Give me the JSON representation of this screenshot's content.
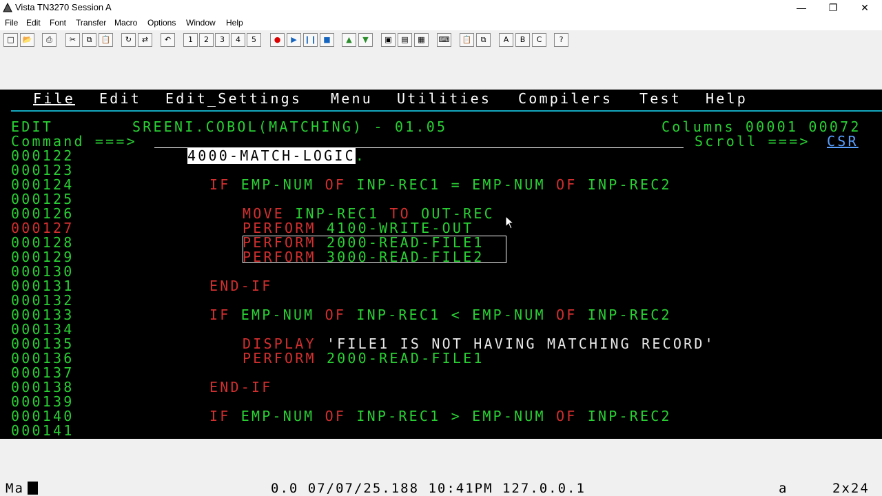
{
  "window": {
    "title": "Vista TN3270 Session A",
    "minimize_glyph": "—",
    "restore_glyph": "❐",
    "close_glyph": "✕"
  },
  "menubar": [
    "File",
    "Edit",
    "Font",
    "Transfer",
    "Macro",
    "Options",
    "Window",
    "Help"
  ],
  "toolbar": {
    "buttons": [
      "new",
      "open",
      "print",
      "cut",
      "copy",
      "paste",
      "refresh",
      "reconnect",
      "undo",
      "1",
      "2",
      "3",
      "4",
      "5",
      "record",
      "play",
      "pause",
      "stop",
      "upload",
      "download",
      "screen1",
      "screen2",
      "screen3",
      "keyboard",
      "clip1",
      "clip2",
      "A",
      "B",
      "C",
      "?"
    ]
  },
  "ispf": {
    "menu": [
      "File",
      "Edit",
      "Edit_Settings",
      "Menu",
      "Utilities",
      "Compilers",
      "Test",
      "Help"
    ],
    "mode": "EDIT",
    "dataset": "SREENI.COBOL(MATCHING) - 01.05",
    "columns": "Columns 00001 00072",
    "command_label": "Command ===>",
    "scroll_label": "Scroll ===>",
    "scroll_value": "CSR"
  },
  "lines": [
    {
      "num": "000122",
      "code": "4000-MATCH-LOGIC."
    },
    {
      "num": "000123",
      "code": ""
    },
    {
      "num": "000124",
      "code": "IF EMP-NUM OF INP-REC1 = EMP-NUM OF INP-REC2"
    },
    {
      "num": "000125",
      "code": ""
    },
    {
      "num": "000126",
      "code": "MOVE INP-REC1 TO OUT-REC"
    },
    {
      "num": "000127",
      "code": "PERFORM 4100-WRITE-OUT"
    },
    {
      "num": "000128",
      "code": "PERFORM 2000-READ-FILE1"
    },
    {
      "num": "000129",
      "code": "PERFORM 3000-READ-FILE2"
    },
    {
      "num": "000130",
      "code": ""
    },
    {
      "num": "000131",
      "code": "END-IF"
    },
    {
      "num": "000132",
      "code": ""
    },
    {
      "num": "000133",
      "code": "IF EMP-NUM OF INP-REC1 < EMP-NUM OF INP-REC2"
    },
    {
      "num": "000134",
      "code": ""
    },
    {
      "num": "000135",
      "code": "DISPLAY 'FILE1 IS NOT HAVING MATCHING RECORD'"
    },
    {
      "num": "000136",
      "code": "PERFORM 2000-READ-FILE1"
    },
    {
      "num": "000137",
      "code": ""
    },
    {
      "num": "000138",
      "code": "END-IF"
    },
    {
      "num": "000139",
      "code": ""
    },
    {
      "num": "000140",
      "code": "IF EMP-NUM OF INP-REC1 > EMP-NUM OF INP-REC2"
    },
    {
      "num": "000141",
      "code": ""
    }
  ],
  "statusbar": {
    "left": "Ma",
    "center": "0.0 07/07/25.188 10:41PM 127.0.0.1",
    "mode": "a",
    "position": "2x24"
  }
}
